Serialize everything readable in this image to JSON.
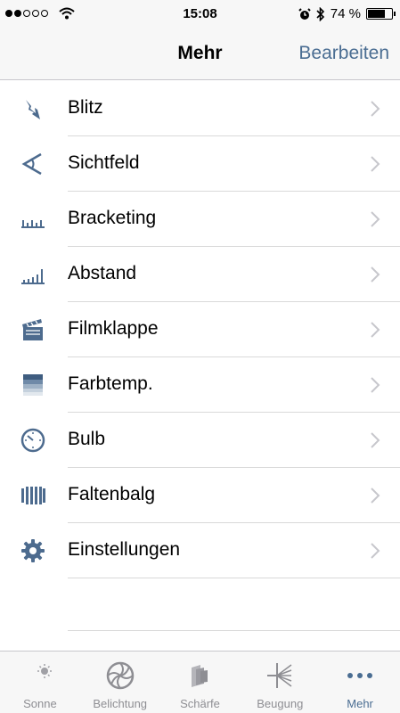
{
  "status_bar": {
    "time": "15:08",
    "battery": "74 %",
    "battery_level": 0.74
  },
  "nav": {
    "title": "Mehr",
    "edit_label": "Bearbeiten"
  },
  "menu": {
    "items": [
      {
        "label": "Blitz",
        "icon": "flash-icon"
      },
      {
        "label": "Sichtfeld",
        "icon": "field-of-view-icon"
      },
      {
        "label": "Bracketing",
        "icon": "bracketing-icon"
      },
      {
        "label": "Abstand",
        "icon": "distance-icon"
      },
      {
        "label": "Filmklappe",
        "icon": "clapperboard-icon"
      },
      {
        "label": "Farbtemp.",
        "icon": "color-temperature-icon"
      },
      {
        "label": "Bulb",
        "icon": "stopwatch-icon"
      },
      {
        "label": "Faltenbalg",
        "icon": "bellows-icon"
      },
      {
        "label": "Einstellungen",
        "icon": "gear-icon"
      }
    ]
  },
  "tabs": [
    {
      "label": "Sonne",
      "icon": "sun-moon-icon",
      "active": false
    },
    {
      "label": "Belichtung",
      "icon": "aperture-icon",
      "active": false
    },
    {
      "label": "Schärfe",
      "icon": "focus-layers-icon",
      "active": false
    },
    {
      "label": "Beugung",
      "icon": "diffraction-icon",
      "active": false
    },
    {
      "label": "Mehr",
      "icon": "more-icon",
      "active": true
    }
  ],
  "colors": {
    "accent": "#4a6d92",
    "icon": "#4d6b8e",
    "inactive_tab": "#8e8e93",
    "bar_background": "#f7f7f7"
  }
}
